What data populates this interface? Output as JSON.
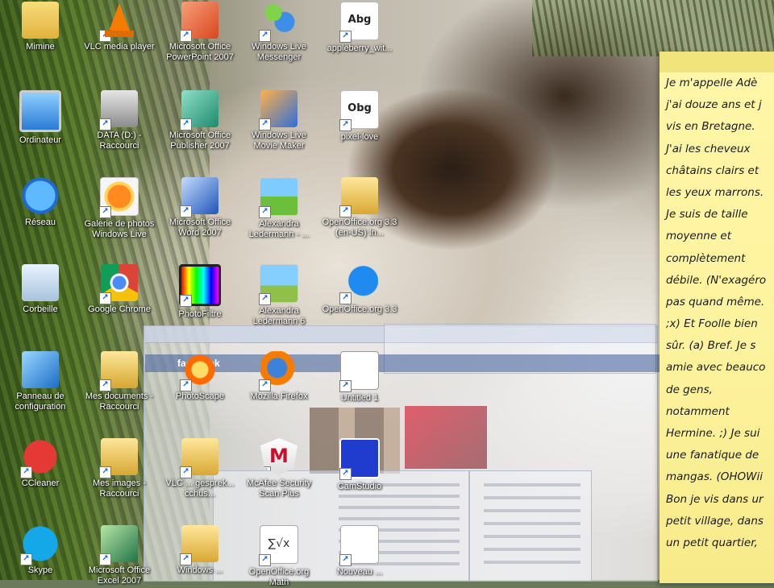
{
  "desktop": {
    "icons": [
      {
        "label": "Mimine",
        "icon": "user-folder-icon"
      },
      {
        "label": "VLC media player",
        "icon": "vlc-icon"
      },
      {
        "label": "Microsoft Office PowerPoint 2007",
        "icon": "powerpoint-icon"
      },
      {
        "label": "Windows Live Messenger",
        "icon": "messenger-icon"
      },
      {
        "label": "appleberry_wit...",
        "icon": "font-file-icon",
        "glyph": "Abg"
      },
      {
        "label": "Ordinateur",
        "icon": "computer-icon"
      },
      {
        "label": "DATA (D:) - Raccourci",
        "icon": "drive-icon"
      },
      {
        "label": "Microsoft Office Publisher 2007",
        "icon": "publisher-icon"
      },
      {
        "label": "Windows Live Movie Maker",
        "icon": "movie-maker-icon"
      },
      {
        "label": "pixel-love",
        "icon": "font-file-icon",
        "glyph": "Obg"
      },
      {
        "label": "Réseau",
        "icon": "network-icon"
      },
      {
        "label": "Galerie de photos Windows Live",
        "icon": "photo-gallery-icon"
      },
      {
        "label": "Microsoft Office Word 2007",
        "icon": "word-icon"
      },
      {
        "label": "Alexandra Ledermann - ...",
        "icon": "game-icon"
      },
      {
        "label": "OpenOffice.org 3.3 (en-US) In...",
        "icon": "folder-icon"
      },
      {
        "label": "Corbeille",
        "icon": "recycle-bin-icon"
      },
      {
        "label": "Google Chrome",
        "icon": "chrome-icon"
      },
      {
        "label": "PhotoFiltre",
        "icon": "photofiltre-icon"
      },
      {
        "label": "Alexandra Ledermann 6",
        "icon": "horse-game-icon"
      },
      {
        "label": "OpenOffice.org 3.3",
        "icon": "openoffice-icon"
      },
      {
        "label": "Panneau de configuration",
        "icon": "control-panel-icon"
      },
      {
        "label": "Mes documents - Raccourci",
        "icon": "documents-folder-icon"
      },
      {
        "label": "PhotoScape",
        "icon": "photoscape-icon"
      },
      {
        "label": "Mozilla Firefox",
        "icon": "firefox-icon"
      },
      {
        "label": "Untitled 1",
        "icon": "blank-document-icon"
      },
      {
        "label": "CCleaner",
        "icon": "ccleaner-icon"
      },
      {
        "label": "Mes images - Raccourci",
        "icon": "pictures-folder-icon"
      },
      {
        "label": "VLC ... gesprek... cchus...",
        "icon": "folder-icon"
      },
      {
        "label": "McAfee Security Scan Plus",
        "icon": "mcafee-icon"
      },
      {
        "label": "CamStudio",
        "icon": "camstudio-icon"
      },
      {
        "label": "Skype",
        "icon": "skype-icon"
      },
      {
        "label": "Microsoft Office Excel 2007",
        "icon": "excel-icon"
      },
      {
        "label": "Windows ...",
        "icon": "folder-icon"
      },
      {
        "label": "OpenOffice.org Math",
        "icon": "formula-icon",
        "glyph": "∑√x"
      },
      {
        "label": "Nouveau ...",
        "icon": "document-icon"
      }
    ]
  },
  "overlay": {
    "facebook_title": "facebook"
  },
  "sticky_note": {
    "lines": [
      "Je m'appelle Adè",
      "j'ai douze ans et j",
      "vis en Bretagne.",
      "J'ai les cheveux",
      "châtains clairs et",
      "les yeux marrons.",
      "Je suis de taille",
      "moyenne et",
      "complètement",
      "débile. (N'exagéro",
      "pas quand même.",
      ";x) Et Foolle bien",
      "sûr. (a) Bref. Je s",
      "amie avec beauco",
      "de gens,",
      "notamment",
      "Hermine. ;) Je sui",
      "une fanatique de",
      "mangas. (OHOWii",
      "Bon je vis dans ur",
      "petit village, dans",
      "un petit quartier,"
    ]
  }
}
